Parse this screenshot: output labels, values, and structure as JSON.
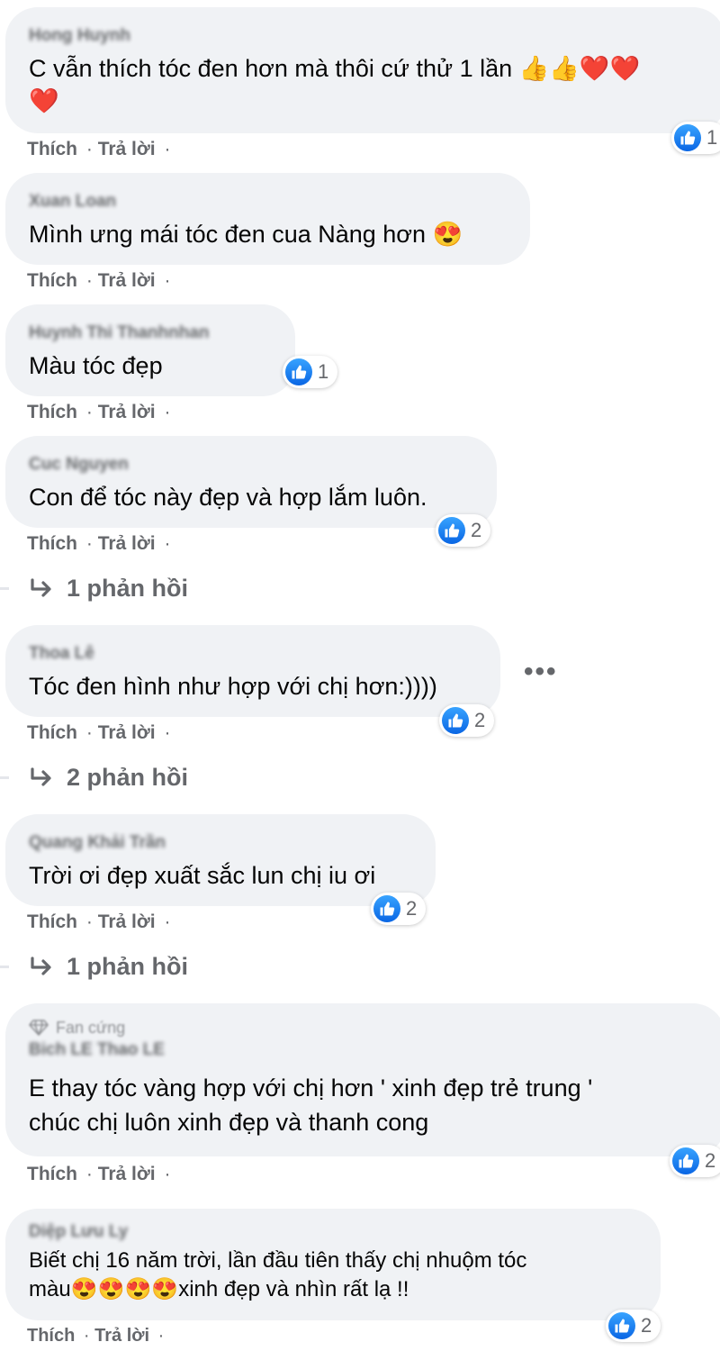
{
  "actions": {
    "like_label": "Thích",
    "reply_label": "Trả lời",
    "dot": "·"
  },
  "comments": [
    {
      "author": "Hong Huynh",
      "text_lines": [
        "C vẫn thích tóc đen hơn mà thôi cứ thử 1 lần 👍👍❤️❤️",
        "❤️"
      ],
      "reaction_count": "1"
    },
    {
      "author": "Xuan Loan",
      "text_lines": [
        "Mình ưng mái tóc đen cua Nàng hơn 😍"
      ],
      "reaction_count": ""
    },
    {
      "author": "Huynh Thi Thanhnhan",
      "text_lines": [
        "Màu tóc đẹp"
      ],
      "reaction_count": "1"
    },
    {
      "author": "Cuc Nguyen",
      "text_lines": [
        "Con để tóc này đẹp và hợp lắm luôn."
      ],
      "reaction_count": "2",
      "replies_label": "1 phản hồi"
    },
    {
      "author": "Thoa Lê",
      "text_lines": [
        "Tóc đen hình như hợp với chị hơn:))))"
      ],
      "reaction_count": "2",
      "replies_label": "2 phản hồi",
      "more_label": "•••"
    },
    {
      "author": "Quang Khải Trần",
      "text_lines": [
        "Trời ơi đẹp xuất sắc lun chị iu ơi"
      ],
      "reaction_count": "2",
      "replies_label": "1 phản hồi"
    },
    {
      "badge": "Fan cứng",
      "author": "Bich LE Thao LE",
      "text_lines": [
        "E thay tóc vàng hợp với chị hơn ' xinh đẹp trẻ trung '",
        "chúc chị luôn xinh đẹp và thanh cong"
      ],
      "reaction_count": "2"
    },
    {
      "author": "Diệp Lưu Ly",
      "text_lines": [
        "Biết chị 16 năm trời, lần đầu tiên thấy chị nhuộm tóc",
        "màu😍😍😍😍xinh đẹp và nhìn rất lạ !!"
      ],
      "reaction_count": "2"
    }
  ]
}
